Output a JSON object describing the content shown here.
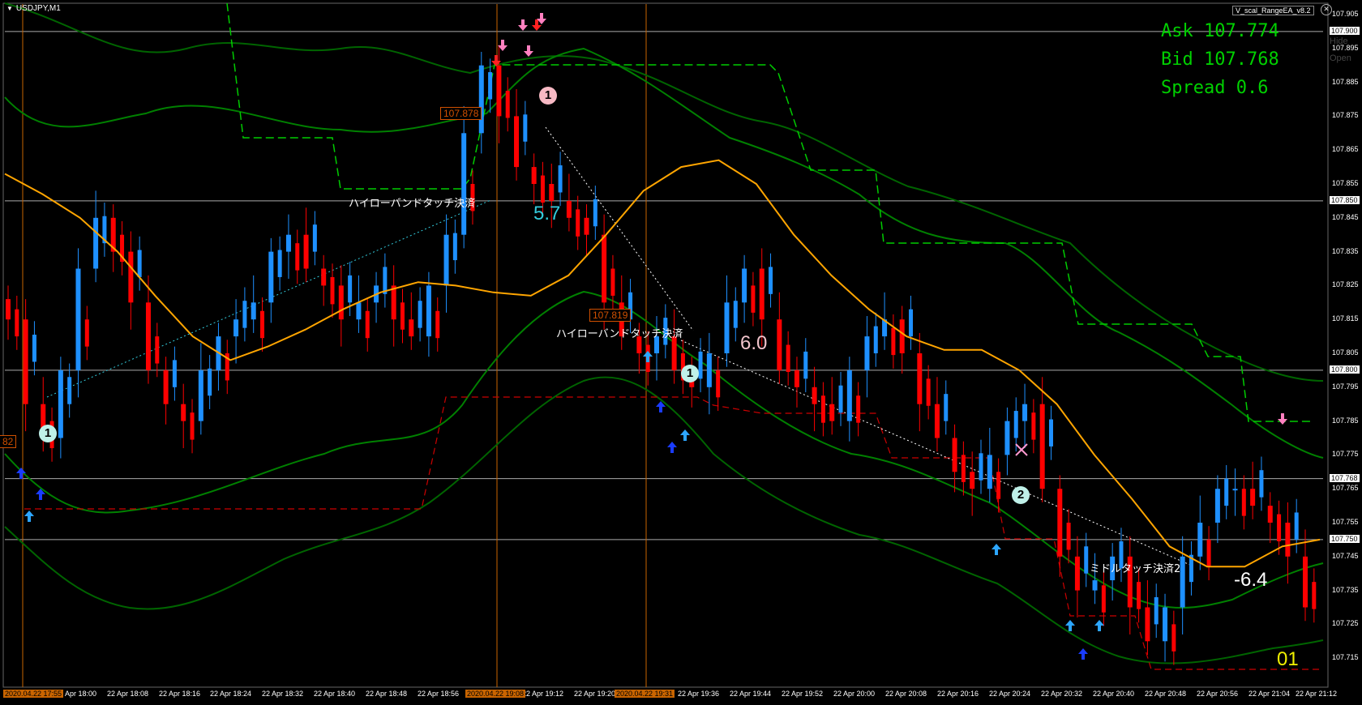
{
  "window": {
    "symbol": "USDJPY,M1",
    "ea_name": "V_scal_RangeEA_v8.2"
  },
  "quotes": {
    "ask": "Ask 107.774",
    "bid": "Bid 107.768",
    "spread": "Spread 0.6"
  },
  "side_buttons": {
    "hide": "Hide",
    "open": "Open"
  },
  "colors": {
    "bull": "#1e90ff",
    "bear": "#ff0000",
    "ma": "#ffa500",
    "band": "#008000",
    "band_outer": "#006400",
    "range_high": "#00cc00",
    "range_low": "#cc0000",
    "quote": "#00d000",
    "grid": "#aaaaaa"
  },
  "price_axis": {
    "ticks": [
      "107.905",
      "107.895",
      "107.885",
      "107.875",
      "107.865",
      "107.855",
      "107.845",
      "107.835",
      "107.825",
      "107.815",
      "107.805",
      "107.795",
      "107.785",
      "107.775",
      "107.765",
      "107.755",
      "107.745",
      "107.735",
      "107.725",
      "107.715"
    ],
    "boxed": [
      "107.900",
      "107.850",
      "107.800",
      "107.768",
      "107.750"
    ]
  },
  "time_axis": {
    "labels": [
      "22 Apr 18:00",
      "22 Apr 18:08",
      "22 Apr 18:16",
      "22 Apr 18:24",
      "22 Apr 18:32",
      "22 Apr 18:40",
      "22 Apr 18:48",
      "22 Apr 18:56",
      "22 Apr 19:12",
      "22 Apr 19:20",
      "22 Apr 19:36",
      "22 Apr 19:44",
      "22 Apr 19:52",
      "22 Apr 20:00",
      "22 Apr 20:08",
      "22 Apr 20:16",
      "22 Apr 20:24",
      "22 Apr 20:32",
      "22 Apr 20:40",
      "22 Apr 20:48",
      "22 Apr 20:56",
      "22 Apr 21:04",
      "22 Apr 21:12"
    ],
    "boxed": [
      "2020.04.22 17:55",
      "2020.04.22 19:08",
      "2020.04.22 19:31"
    ]
  },
  "annotations": {
    "high_band_close_1": "ハイローバンドタッチ決済",
    "high_band_close_2": "ハイローバンドタッチ決済",
    "middle_touch_close": "ミドルタッチ決済2",
    "pips_1": "5.7",
    "pips_2": "6.0",
    "pips_3": "-6.4",
    "price_tag_1": "107.878",
    "price_tag_2": "107.819",
    "price_tag_left": "82",
    "corner_number": "01",
    "trade_marks": [
      "1",
      "1",
      "1",
      "2"
    ]
  },
  "chart_data": {
    "type": "candlestick",
    "title": "",
    "ylim": [
      107.713,
      107.908
    ],
    "horizontal_lines": [
      107.9,
      107.85,
      107.8,
      107.768,
      107.75
    ],
    "vertical_lines": [
      "2020.04.22 17:55",
      "2020.04.22 19:08",
      "2020.04.22 19:31"
    ],
    "series": [
      {
        "kind": "close_path",
        "values": [
          107.815,
          107.79,
          107.78,
          107.8,
          107.83,
          107.845,
          107.835,
          107.82,
          107.8,
          107.79,
          107.785,
          107.8,
          107.81,
          107.815,
          107.82,
          107.835,
          107.84,
          107.83,
          107.825,
          107.815,
          107.82,
          107.825,
          107.815,
          107.81,
          107.825,
          107.84,
          107.87,
          107.89,
          107.875,
          107.86,
          107.855,
          107.85,
          107.845,
          107.84,
          107.82,
          107.81,
          107.805,
          107.81,
          107.8,
          107.795,
          107.805,
          107.82,
          107.83,
          107.815,
          107.8,
          107.795,
          107.79,
          107.785,
          107.8,
          107.81,
          107.815,
          107.805,
          107.79,
          107.78,
          107.77,
          107.765,
          107.775,
          107.785,
          107.79,
          107.765,
          107.745,
          107.735,
          107.738,
          107.745,
          107.73,
          107.72,
          107.73,
          107.745,
          107.755,
          107.765,
          107.765,
          107.76,
          107.755,
          107.745,
          107.73
        ]
      },
      {
        "kind": "ma",
        "name": "",
        "values": [
          107.858,
          107.852,
          107.845,
          107.835,
          107.822,
          107.81,
          107.803,
          107.807,
          107.812,
          107.818,
          107.823,
          107.826,
          107.825,
          107.823,
          107.822,
          107.828,
          107.84,
          107.853,
          107.86,
          107.862,
          107.855,
          107.84,
          107.828,
          107.818,
          107.81,
          107.806,
          107.806,
          107.8,
          107.79,
          107.775,
          107.762,
          107.748,
          107.742,
          107.742,
          107.748,
          107.75
        ]
      }
    ]
  }
}
